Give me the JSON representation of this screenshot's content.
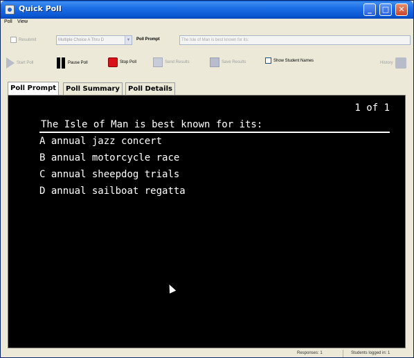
{
  "window": {
    "title": "Quick Poll",
    "controls": [
      "minimize-icon",
      "maximize-icon",
      "close-icon"
    ]
  },
  "menu": {
    "items": [
      "Poll",
      "View"
    ]
  },
  "question_bar": {
    "resubmit_label": "Resubmit",
    "resubmit_checked": false,
    "question_type": "Multiple Choice A Thru D",
    "prompt_label": "Poll Prompt",
    "prompt_value": "The Isle of Man is best known for its:"
  },
  "toolbar": {
    "start_poll": "Start Poll",
    "pause_poll": "Pause Poll",
    "stop_poll": "Stop Poll",
    "send_results": "Send Results",
    "save_results": "Save Results",
    "show_student_names": "Show Student Names",
    "show_student_names_checked": false,
    "history": "History"
  },
  "tabs": [
    {
      "label": "Poll Prompt",
      "active": true
    },
    {
      "label": "Poll Summary",
      "active": false
    },
    {
      "label": "Poll Details",
      "active": false
    }
  ],
  "prompt_display": {
    "page_counter": "1 of 1",
    "question": "The Isle of Man is best known for its:",
    "options": [
      {
        "letter": "A",
        "text": "annual jazz concert"
      },
      {
        "letter": "B",
        "text": "annual motorcycle race"
      },
      {
        "letter": "C",
        "text": "annual sheepdog trials"
      },
      {
        "letter": "D",
        "text": "annual sailboat regatta"
      }
    ]
  },
  "status": {
    "responses": "Responses: 1",
    "students_logged_in": "Students logged in: 1"
  },
  "colors": {
    "title_bar": "#0a56d2",
    "content_bg": "#000000",
    "content_text": "#ffffff",
    "stop_icon": "#d8101a",
    "window_bg": "#ece9d8"
  }
}
